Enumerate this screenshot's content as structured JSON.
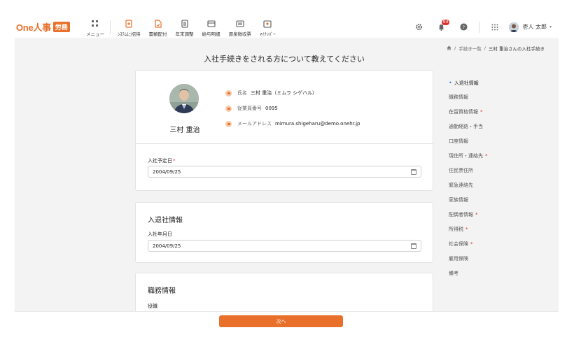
{
  "header": {
    "logo_text": "One人事",
    "logo_badge": "労務",
    "nav": [
      {
        "label": "メニュー",
        "icon": "grid-icon"
      },
      {
        "label": "ｼｽﾃﾑに招待",
        "icon": "invite-icon"
      },
      {
        "label": "書類配付",
        "icon": "document-send-icon"
      },
      {
        "label": "年末調整",
        "icon": "year-end-icon"
      },
      {
        "label": "給与明細",
        "icon": "payslip-icon"
      },
      {
        "label": "源泉徴収票",
        "icon": "withholding-icon"
      },
      {
        "label": "ﾏｲﾅﾝﾊﾞｰ",
        "icon": "mynumber-icon"
      }
    ],
    "notification_count": "94",
    "user_name": "壱人 太郎"
  },
  "breadcrumb": {
    "list": "手続き一覧",
    "current": "三村 重治さんの入社手続き"
  },
  "page_title": "入社手続きをされる方について教えてください",
  "profile": {
    "name": "三村 重治",
    "name_label": "氏名",
    "name_value": "三村 重治（ミムラ シゲハル）",
    "employee_no_label": "従業員番号",
    "employee_no_value": "0095",
    "email_label": "メールアドレス",
    "email_value": "mimura.shigeharu@demo.onehr.jp"
  },
  "join_date": {
    "label": "入社予定日",
    "value": "2004/09/25"
  },
  "entry_exit": {
    "title": "入退社情報",
    "field_label": "入社年月日",
    "value": "2004/09/25"
  },
  "job": {
    "title": "職務情報",
    "field_label": "役職"
  },
  "sidenav": [
    {
      "label": "入退社情報",
      "required": false,
      "active": true
    },
    {
      "label": "職務情報",
      "required": false
    },
    {
      "label": "在留資格情報",
      "required": true
    },
    {
      "label": "通勤経路・手当",
      "required": false
    },
    {
      "label": "口座情報",
      "required": false
    },
    {
      "label": "現住所・連絡先",
      "required": true
    },
    {
      "label": "住民票住所",
      "required": false
    },
    {
      "label": "緊急連絡先",
      "required": false
    },
    {
      "label": "家族情報",
      "required": false
    },
    {
      "label": "配偶者情報",
      "required": true
    },
    {
      "label": "所得税",
      "required": true
    },
    {
      "label": "社会保険",
      "required": true
    },
    {
      "label": "雇用保険",
      "required": false
    },
    {
      "label": "備考",
      "required": false
    }
  ],
  "footer": {
    "next_label": "次へ"
  },
  "colors": {
    "accent": "#e8702a",
    "required": "#d9342b",
    "active_dot": "#2b7bd6"
  }
}
